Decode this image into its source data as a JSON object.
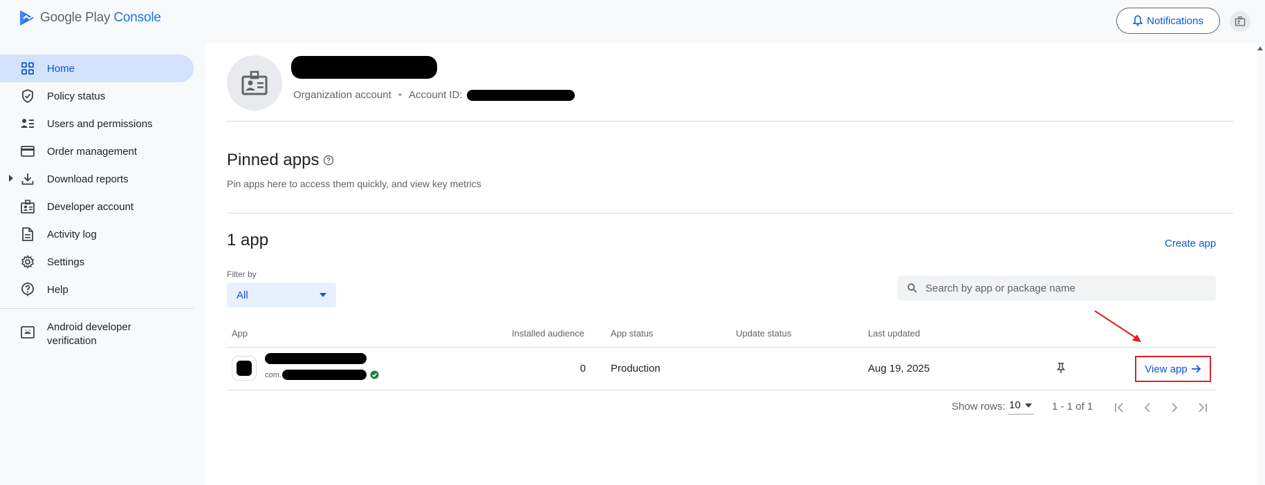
{
  "header": {
    "logo_text_main": "Google Play",
    "logo_text_accent": "Console",
    "notifications_label": "Notifications",
    "icons": {
      "logo": "play-console-logo",
      "bell": "bell-icon",
      "account": "account-badge-icon"
    }
  },
  "sidebar": {
    "items": [
      {
        "label": "Home",
        "icon": "home-grid-icon",
        "active": true
      },
      {
        "label": "Policy status",
        "icon": "shield-check-icon"
      },
      {
        "label": "Users and permissions",
        "icon": "users-icon"
      },
      {
        "label": "Order management",
        "icon": "credit-card-icon"
      },
      {
        "label": "Download reports",
        "icon": "download-icon"
      },
      {
        "label": "Developer account",
        "icon": "developer-badge-icon"
      },
      {
        "label": "Activity log",
        "icon": "document-icon"
      },
      {
        "label": "Settings",
        "icon": "gear-icon"
      },
      {
        "label": "Help",
        "icon": "help-icon"
      }
    ],
    "verification_label": "Android developer verification"
  },
  "account": {
    "org_label": "Organization account",
    "account_id_label": "Account ID:"
  },
  "pinned": {
    "title": "Pinned apps",
    "subtitle": "Pin apps here to access them quickly, and view key metrics"
  },
  "apps": {
    "count_title": "1 app",
    "create_label": "Create app",
    "filter_label": "Filter by",
    "filter_value": "All",
    "search_placeholder": "Search by app or package name",
    "columns": [
      "App",
      "Installed audience",
      "App status",
      "Update status",
      "Last updated"
    ],
    "rows": [
      {
        "package_prefix": "com.",
        "installed_audience": "0",
        "app_status": "Production",
        "update_status": "",
        "last_updated": "Aug 19, 2025",
        "action_label": "View app"
      }
    ],
    "pagination": {
      "show_rows_label": "Show rows:",
      "rows_value": "10",
      "range": "1 - 1 of 1"
    }
  },
  "colors": {
    "accent": "#0b57d0",
    "active_nav_bg": "#d3e3fd",
    "annotation_red": "#e31e24",
    "verified_green": "#188038"
  }
}
